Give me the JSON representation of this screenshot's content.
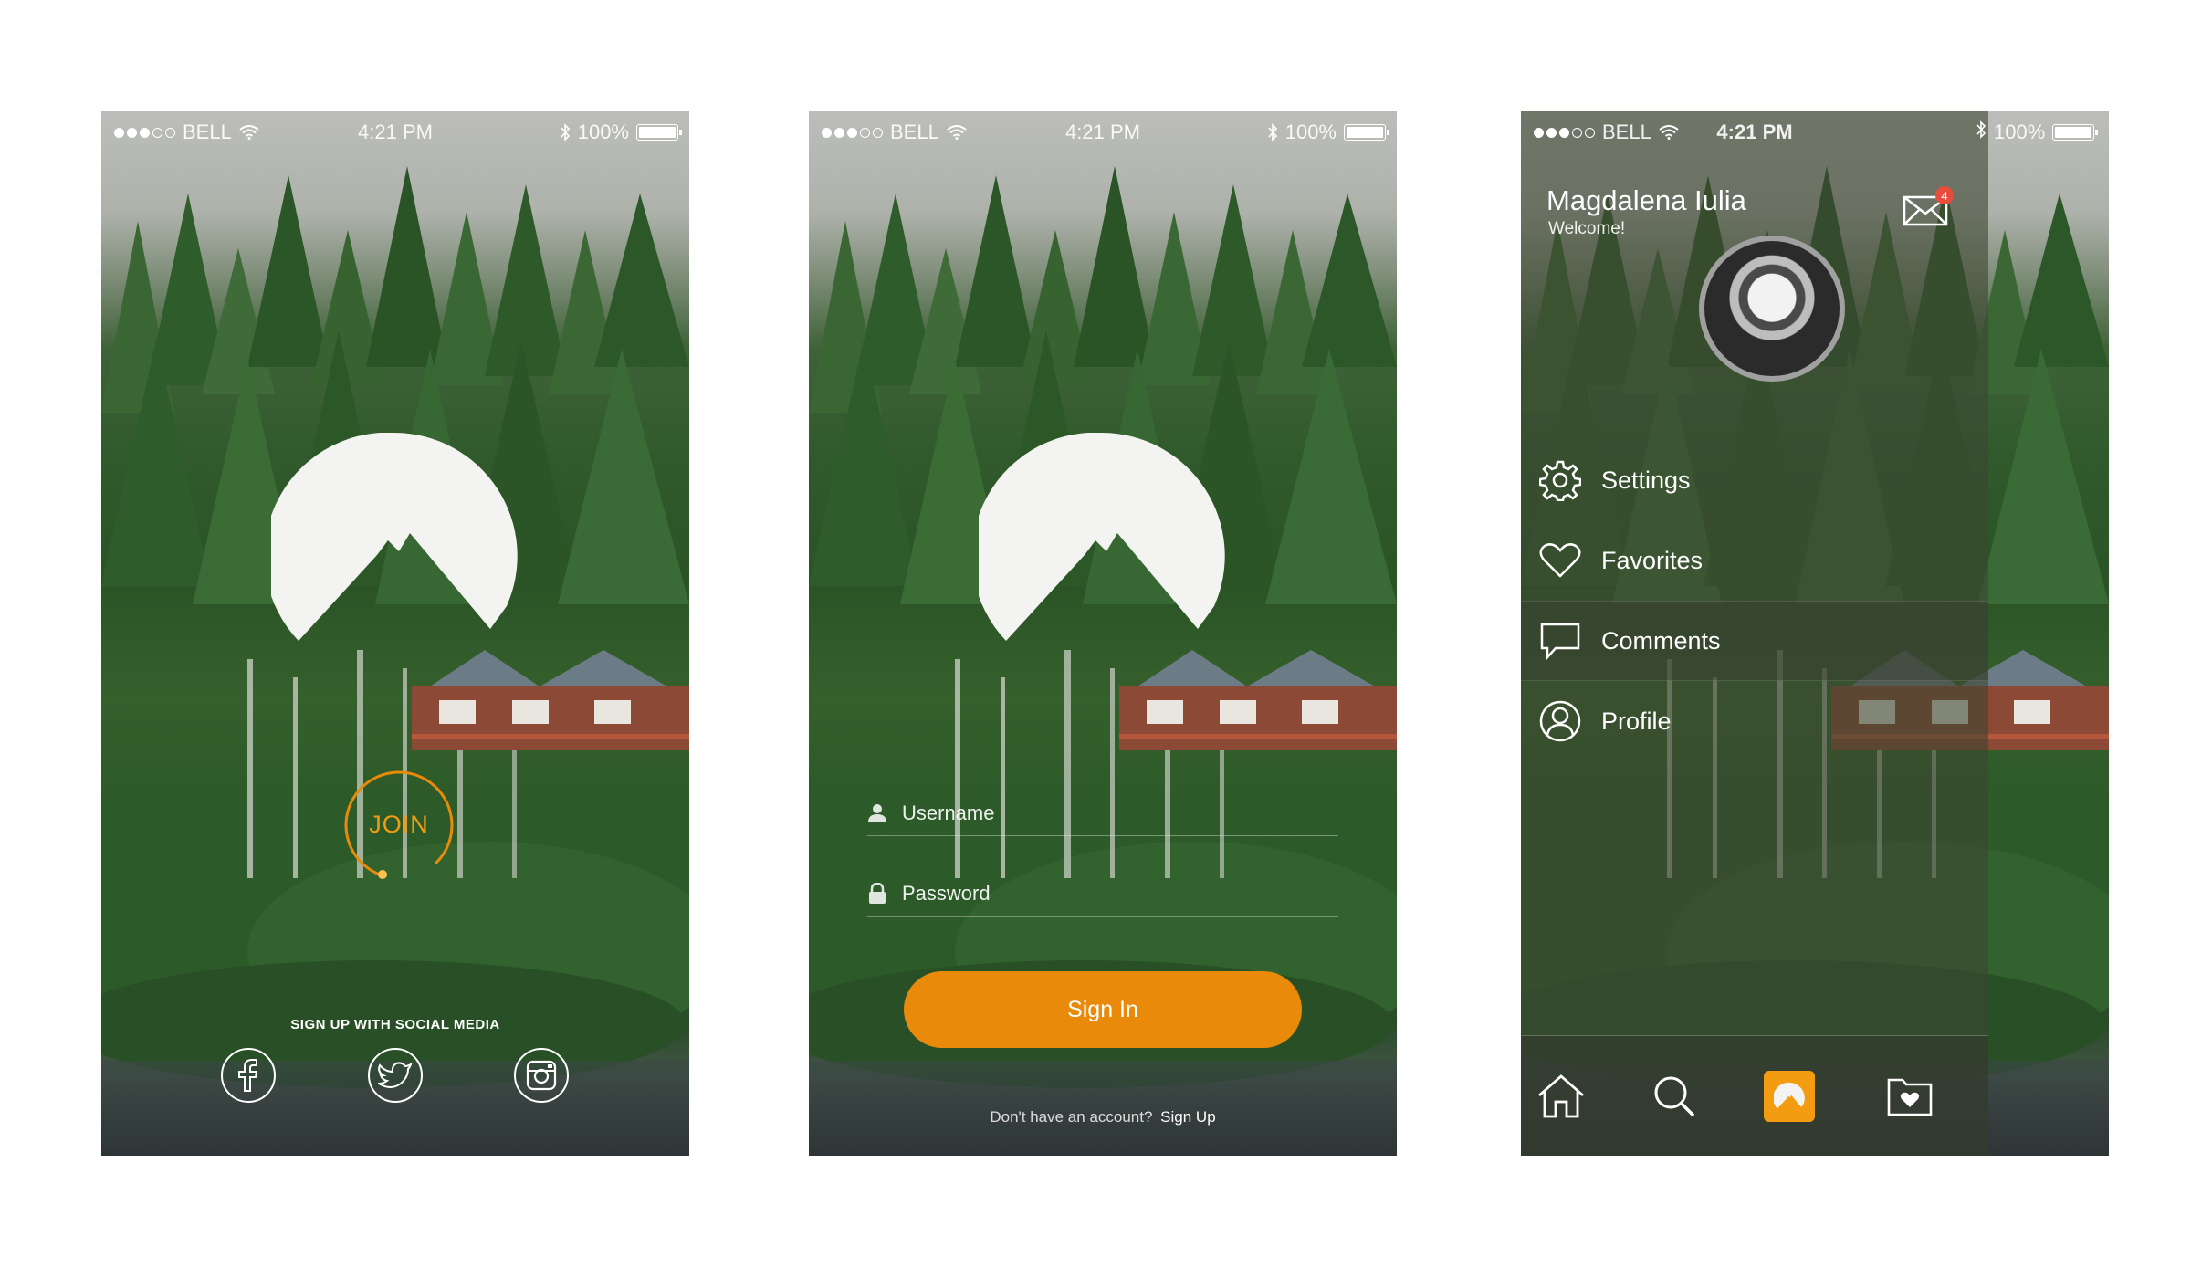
{
  "statusbar": {
    "carrier": "BELL",
    "time": "4:21 PM",
    "battery": "100%"
  },
  "screen1": {
    "join_label": "JOIN",
    "social_title": "SIGN UP WITH SOCIAL MEDIA",
    "social_icons": [
      "facebook-icon",
      "twitter-icon",
      "instagram-icon"
    ]
  },
  "screen2": {
    "username_placeholder": "Username",
    "password_placeholder": "Password",
    "signin_label": "Sign In",
    "no_account_text": "Don't have an account?",
    "signup_link": "Sign Up"
  },
  "screen3": {
    "user_name": "Magdalena Iulia",
    "welcome": "Welcome!",
    "mail_badge": "4",
    "menu": [
      {
        "label": "Settings",
        "icon": "gear-icon"
      },
      {
        "label": "Favorites",
        "icon": "heart-icon"
      },
      {
        "label": "Comments",
        "icon": "comment-icon"
      },
      {
        "label": "Profile",
        "icon": "profile-icon"
      }
    ],
    "tabbar": [
      "home-icon",
      "search-icon",
      "app-logo-icon",
      "saved-folder-icon"
    ]
  },
  "colors": {
    "accent": "#ea8a0a",
    "badge": "#e74c3c"
  }
}
